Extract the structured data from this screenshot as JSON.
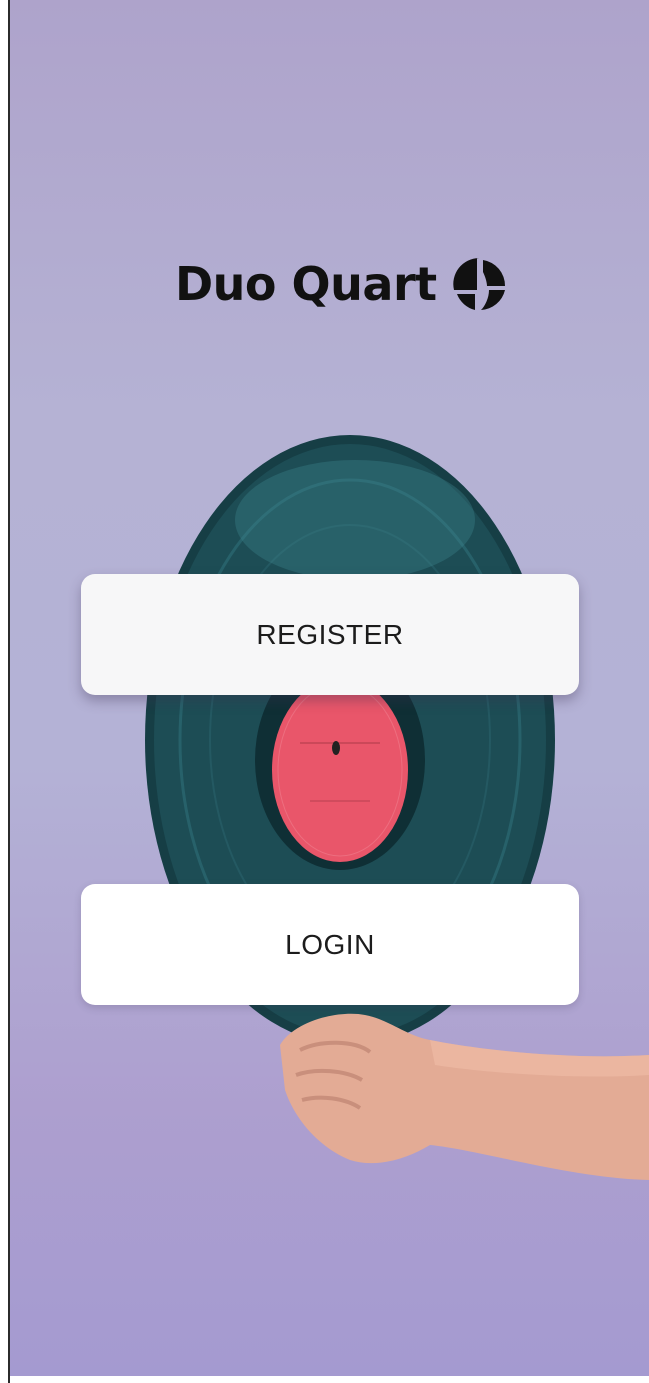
{
  "brand": {
    "name": "Duo Quart",
    "logo_icon": "duo-quart-logo-icon"
  },
  "actions": {
    "register_label": "REGISTER",
    "login_label": "LOGIN"
  },
  "colors": {
    "background_top": "#aea3cb",
    "background_bottom": "#a49ad0",
    "button_background": "#f7f7f8",
    "button_text": "#1c1c1c",
    "record_label": "#e9566a"
  }
}
